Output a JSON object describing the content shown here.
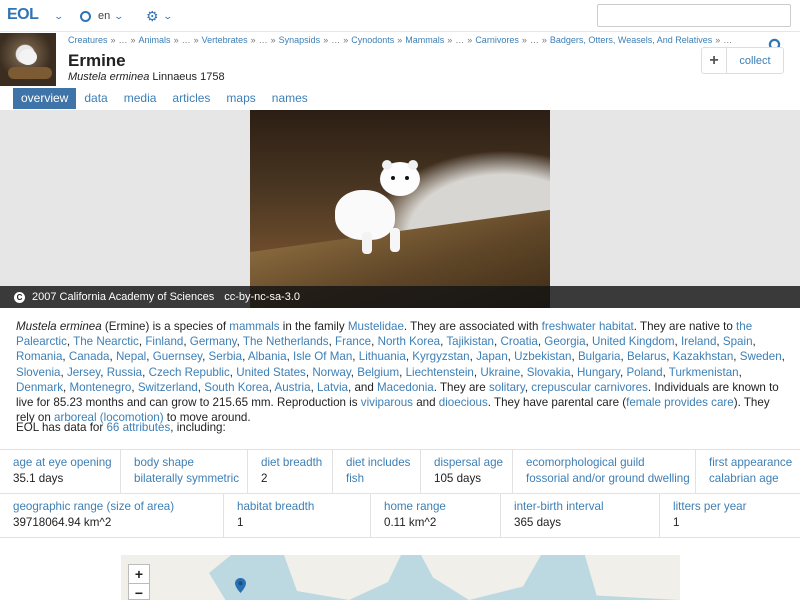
{
  "topbar": {
    "logo": "EOL",
    "language": "en",
    "search_placeholder": ""
  },
  "header": {
    "breadcrumbs": [
      "Creatures",
      "»",
      "…",
      "»",
      "Animals",
      "»",
      "…",
      "»",
      "Vertebrates",
      "»",
      "…",
      "»",
      "Synapsids",
      "»",
      "…",
      "»",
      "Cynodonts",
      "»",
      "Mammals",
      "»",
      "…",
      "»",
      "Carnivores",
      "»",
      "…",
      "»",
      "Badgers, Otters, Weasels, And Relatives",
      "»",
      "…"
    ],
    "title": "Ermine",
    "scientific_name": "Mustela erminea",
    "authority": "Linnaeus 1758",
    "collect_plus": "+",
    "collect_label": "collect"
  },
  "tabs": [
    "overview",
    "data",
    "media",
    "articles",
    "maps",
    "names"
  ],
  "hero": {
    "credit_icon": "C",
    "credit": "2007 California Academy of Sciences",
    "license": "cc-by-nc-sa-3.0"
  },
  "description": {
    "sci_name": "Mustela erminea",
    "t1": " (Ermine) is a species of ",
    "mammals": "mammals",
    "t2": " in the family ",
    "mustelidae": "Mustelidae",
    "t3": ". They are associated with ",
    "freshwater": "freshwater habitat",
    "t4": ". They are native to ",
    "places": [
      "the Palearctic",
      "The Nearctic",
      "Finland",
      "Germany",
      "The Netherlands",
      "France",
      "North Korea",
      "Tajikistan",
      "Croatia",
      "Georgia",
      "United Kingdom",
      "Ireland",
      "Spain",
      "Romania",
      "Canada",
      "Nepal",
      "Guernsey",
      "Serbia",
      "Albania",
      "Isle Of Man",
      "Lithuania",
      "Kyrgyzstan",
      "Japan",
      "Uzbekistan",
      "Bulgaria",
      "Belarus",
      "Kazakhstan",
      "Sweden",
      "Slovenia",
      "Jersey",
      "Russia",
      "Czech Republic",
      "United States",
      "Norway",
      "Belgium",
      "Liechtenstein",
      "Ukraine",
      "Slovakia",
      "Hungary",
      "Poland",
      "Turkmenistan",
      "Denmark",
      "Montenegro",
      "Switzerland",
      "South Korea",
      "Austria",
      "Latvia",
      "Macedonia"
    ],
    "and": "and",
    "t5": ". They are ",
    "solitary": "solitary",
    "crepuscular": "crepuscular carnivores",
    "t6": ". Individuals are known to live for 85.23 months and can grow to 215.65 mm. Reproduction is ",
    "viviparous": "viviparous",
    "t7": " and ",
    "dioecious": "dioecious",
    "t8": ". They have parental care (",
    "female_care": "female provides care",
    "t9": "). They rely on ",
    "arboreal": "arboreal (locomotion)",
    "t10": " to move around."
  },
  "data_intro": {
    "prefix": "EOL has data for ",
    "link": "66 attributes",
    "suffix": ", including:"
  },
  "attributes_row1": [
    {
      "label": "age at eye opening",
      "value": "35.1 days",
      "value_link": false
    },
    {
      "label": "body shape",
      "value": "bilaterally symmetric",
      "value_link": true
    },
    {
      "label": "diet breadth",
      "value": "2",
      "value_link": false
    },
    {
      "label": "diet includes",
      "value": "fish",
      "value_link": true
    },
    {
      "label": "dispersal age",
      "value": "105 days",
      "value_link": false
    },
    {
      "label": "ecomorphological guild",
      "value": "fossorial and/or ground dwelling",
      "value_link": true
    },
    {
      "label": "first appearance",
      "value": "calabrian age",
      "value_link": true
    }
  ],
  "attributes_row2": [
    {
      "label": "geographic range (size of area)",
      "value": "39718064.94 km^2",
      "value_link": false
    },
    {
      "label": "habitat breadth",
      "value": "1",
      "value_link": false
    },
    {
      "label": "home range",
      "value": "0.11 km^2",
      "value_link": false
    },
    {
      "label": "inter-birth interval",
      "value": "365 days",
      "value_link": false
    },
    {
      "label": "litters per year",
      "value": "1",
      "value_link": false
    }
  ],
  "map": {
    "zoom_in": "+",
    "zoom_out": "−"
  }
}
